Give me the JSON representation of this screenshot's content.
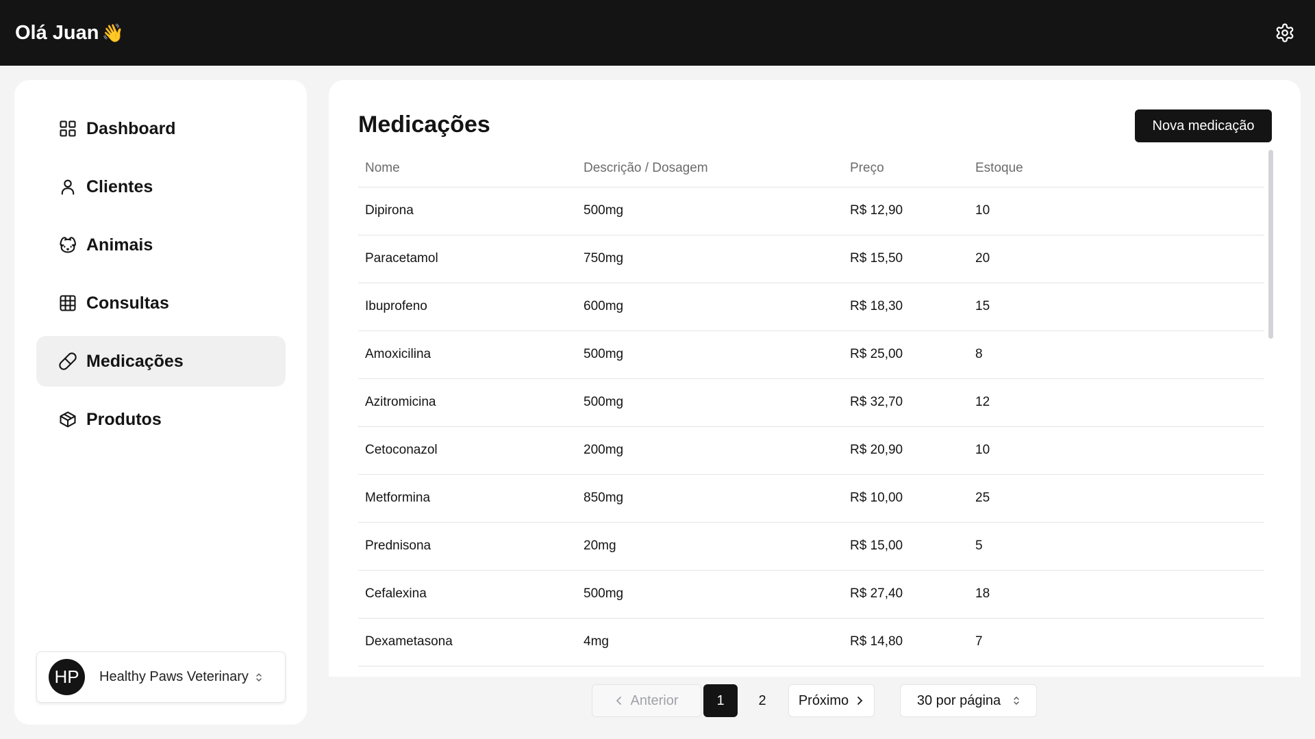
{
  "header": {
    "greeting": "Olá Juan",
    "wave": "👋"
  },
  "sidebar": {
    "items": [
      {
        "label": "Dashboard",
        "icon": "grid-icon"
      },
      {
        "label": "Clientes",
        "icon": "user-icon"
      },
      {
        "label": "Animais",
        "icon": "dog-icon"
      },
      {
        "label": "Consultas",
        "icon": "table-icon"
      },
      {
        "label": "Medicações",
        "icon": "pill-icon",
        "active": true
      },
      {
        "label": "Produtos",
        "icon": "box-icon"
      }
    ],
    "org": {
      "initials": "HP",
      "name": "Healthy Paws Veterinary"
    }
  },
  "main": {
    "title": "Medicações",
    "new_button": "Nova medicação",
    "columns": [
      "Nome",
      "Descrição / Dosagem",
      "Preço",
      "Estoque"
    ],
    "rows": [
      [
        "Dipirona",
        "500mg",
        "R$ 12,90",
        "10"
      ],
      [
        "Paracetamol",
        "750mg",
        "R$ 15,50",
        "20"
      ],
      [
        "Ibuprofeno",
        "600mg",
        "R$ 18,30",
        "15"
      ],
      [
        "Amoxicilina",
        "500mg",
        "R$ 25,00",
        "8"
      ],
      [
        "Azitromicina",
        "500mg",
        "R$ 32,70",
        "12"
      ],
      [
        "Cetoconazol",
        "200mg",
        "R$ 20,90",
        "10"
      ],
      [
        "Metformina",
        "850mg",
        "R$ 10,00",
        "25"
      ],
      [
        "Prednisona",
        "20mg",
        "R$ 15,00",
        "5"
      ],
      [
        "Cefalexina",
        "500mg",
        "R$ 27,40",
        "18"
      ],
      [
        "Dexametasona",
        "4mg",
        "R$ 14,80",
        "7"
      ]
    ]
  },
  "pagination": {
    "previous": "Anterior",
    "pages": [
      "1",
      "2"
    ],
    "current": "1",
    "next": "Próximo",
    "per_page": "30 por página"
  }
}
